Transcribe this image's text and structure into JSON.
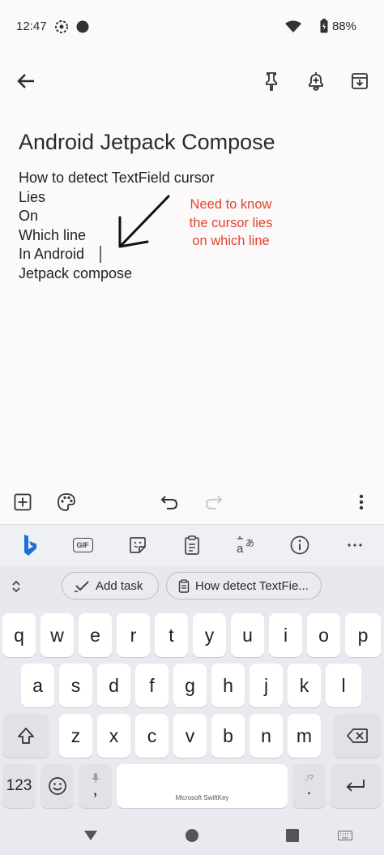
{
  "status": {
    "time": "12:47",
    "battery": "88%"
  },
  "note": {
    "title": "Android Jetpack Compose",
    "lines": [
      "How to detect TextField cursor",
      "Lies",
      "On",
      "Which line",
      "In Android",
      "Jetpack compose"
    ],
    "annotation": [
      "Need to know",
      "the cursor lies",
      "on which line"
    ]
  },
  "keyboard": {
    "suggestions": [
      "Add task",
      "How detect TextFie..."
    ],
    "row1": [
      "q",
      "w",
      "e",
      "r",
      "t",
      "y",
      "u",
      "i",
      "o",
      "p"
    ],
    "row2": [
      "a",
      "s",
      "d",
      "f",
      "g",
      "h",
      "j",
      "k",
      "l"
    ],
    "row3": [
      "z",
      "x",
      "c",
      "v",
      "b",
      "n",
      "m"
    ],
    "numbers_key": "123",
    "space_label": "Microsoft SwiftKey",
    "punct_hint": ",!?",
    "gif_label": "GIF"
  },
  "colors": {
    "annotation": "#e2432a",
    "bing": "#1b6fd8"
  }
}
